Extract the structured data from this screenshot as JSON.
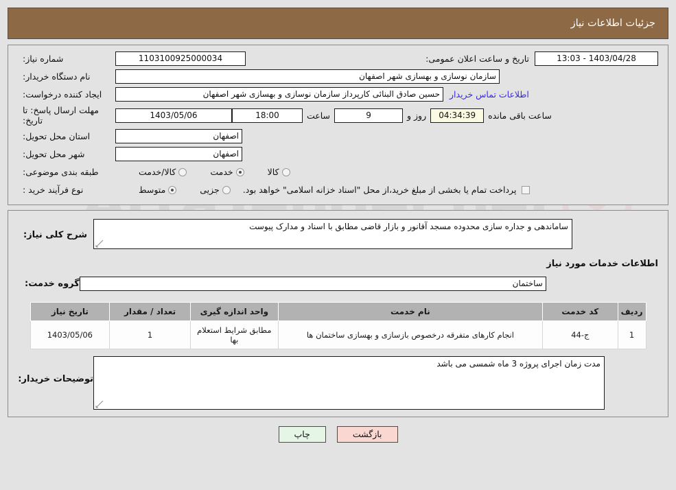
{
  "header": {
    "title": "جزئیات اطلاعات نیاز"
  },
  "watermark": {
    "text": "ArtaTender.net",
    "shield_icon": "shield-icon"
  },
  "top_form": {
    "need_number": {
      "label": "شماره نیاز:",
      "value": "1103100925000034"
    },
    "announce_datetime": {
      "label": "تاریخ و ساعت اعلان عمومی:",
      "value": "1403/04/28 - 13:03"
    },
    "buyer_org": {
      "label": "نام دستگاه خریدار:",
      "value": "سازمان نوسازی و بهسازی شهر اصفهان"
    },
    "request_creator": {
      "label": "ایجاد کننده درخواست:",
      "value": "حسین صادق البنائی کارپرداز سازمان نوسازی و بهسازی شهر اصفهان"
    },
    "contact_link": "اطلاعات تماس خریدار",
    "deadline": {
      "label": "مهلت ارسال پاسخ: تا تاریخ:",
      "date": "1403/05/06",
      "time_label": "ساعت",
      "time": "18:00",
      "days": "9",
      "days_label": "روز و",
      "countdown": "04:34:39",
      "countdown_label": "ساعت باقی مانده"
    },
    "province": {
      "label": "استان محل تحویل:",
      "value": "اصفهان"
    },
    "city": {
      "label": "شهر محل تحویل:",
      "value": "اصفهان"
    },
    "category": {
      "label": "طبقه بندی موضوعی:",
      "options": [
        {
          "label": "کالا",
          "selected": false
        },
        {
          "label": "خدمت",
          "selected": true
        },
        {
          "label": "کالا/خدمت",
          "selected": false
        }
      ]
    },
    "process_type": {
      "label": "نوع فرآیند خرید :",
      "options": [
        {
          "label": "جزیی",
          "selected": false
        },
        {
          "label": "متوسط",
          "selected": true
        }
      ],
      "treasury_checkbox": {
        "checked": false,
        "text": "پرداخت تمام یا بخشی از مبلغ خرید،از محل \"اسناد خزانه اسلامی\" خواهد بود."
      }
    }
  },
  "bottom_form": {
    "need_description": {
      "label": "شرح کلی نیاز:",
      "value": "ساماندهی و جداره سازی محدوده مسجد آقانور و بازار قاضی مطابق با اسناد و مدارک پیوست"
    },
    "services_section_title": "اطلاعات خدمات مورد نیاز",
    "service_group": {
      "label": "گروه خدمت:",
      "value": "ساختمان"
    },
    "table": {
      "columns": [
        "ردیف",
        "کد خدمت",
        "نام خدمت",
        "واحد اندازه گیری",
        "تعداد / مقدار",
        "تاریخ نیاز"
      ],
      "rows": [
        {
          "radif": "1",
          "code": "ج-44",
          "name": "انجام کارهای متفرقه درخصوص بازسازی و بهسازی ساختمان ها",
          "unit": "مطابق شرایط استعلام بها",
          "qty": "1",
          "date": "1403/05/06"
        }
      ]
    },
    "buyer_comments": {
      "label": "توضیحات خریدار:",
      "value": "مدت زمان اجرای پروژه 3 ماه شمسی می باشد"
    }
  },
  "footer": {
    "print_button": "چاپ",
    "return_button": "بازگشت"
  },
  "colors": {
    "header_bg": "#8d6a45",
    "page_bg": "#e3e3e3",
    "link": "#3a2ae0",
    "countdown_bg": "#fbfbe3",
    "table_header_bg": "#b2b2b2",
    "print_btn_bg": "#e6f6e6",
    "return_btn_bg": "#fbd7d2"
  }
}
